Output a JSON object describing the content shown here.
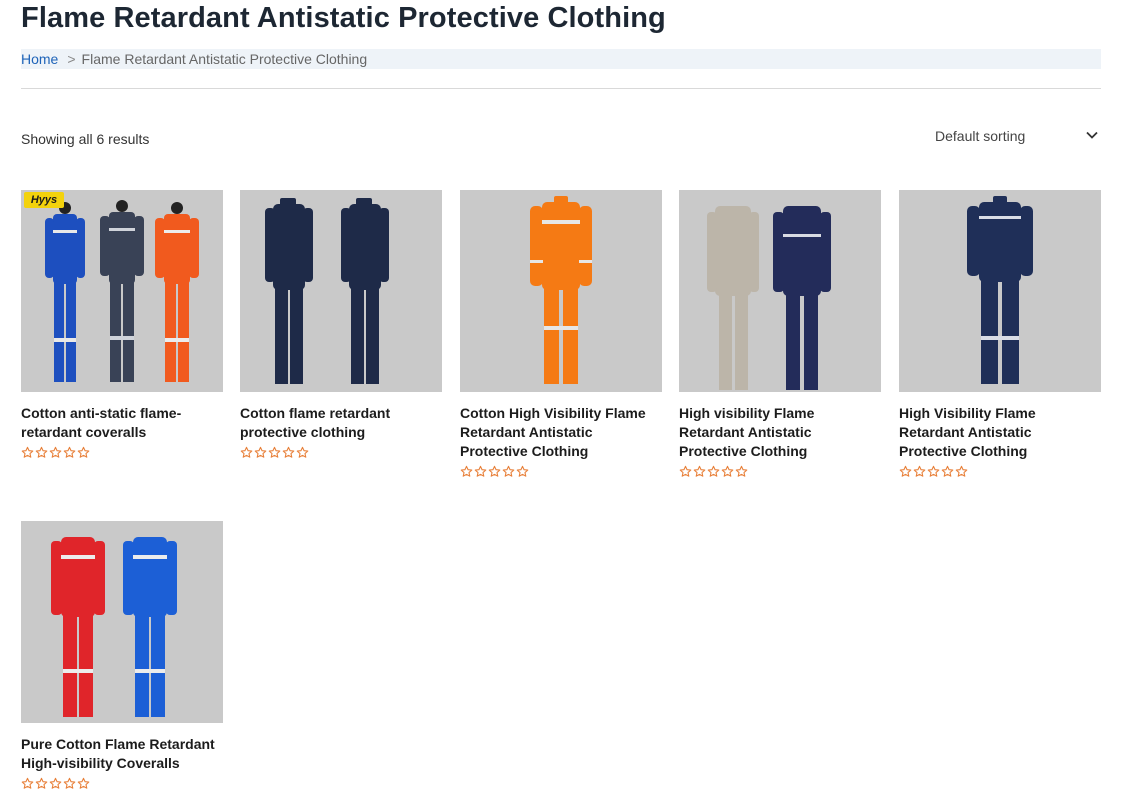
{
  "page": {
    "title": "Flame Retardant Antistatic Protective Clothing"
  },
  "breadcrumb": {
    "home": "Home",
    "separator": ">",
    "current": "Flame Retardant Antistatic Protective Clothing"
  },
  "toolbar": {
    "result_count": "Showing all 6 results",
    "sorting_selected": "Default sorting"
  },
  "colors": {
    "link": "#1e63b8",
    "star": "#e8803a",
    "breadcrumb_bg": "#eef3f8",
    "thumb_bg": "#c9c9c9"
  },
  "products": [
    {
      "title": "Cotton anti-static flame-retardant coveralls",
      "rating": 0,
      "badge": "Hyys"
    },
    {
      "title": "Cotton flame retardant protective clothing",
      "rating": 0
    },
    {
      "title": "Cotton High Visibility Flame Retardant Antistatic Protective Clothing",
      "rating": 0
    },
    {
      "title": "High visibility Flame Retardant Antistatic Protective Clothing",
      "rating": 0
    },
    {
      "title": "High Visibility Flame Retardant Antistatic Protective Clothing",
      "rating": 0
    },
    {
      "title": "Pure Cotton Flame Retardant High-visibility Coveralls",
      "rating": 0
    }
  ]
}
